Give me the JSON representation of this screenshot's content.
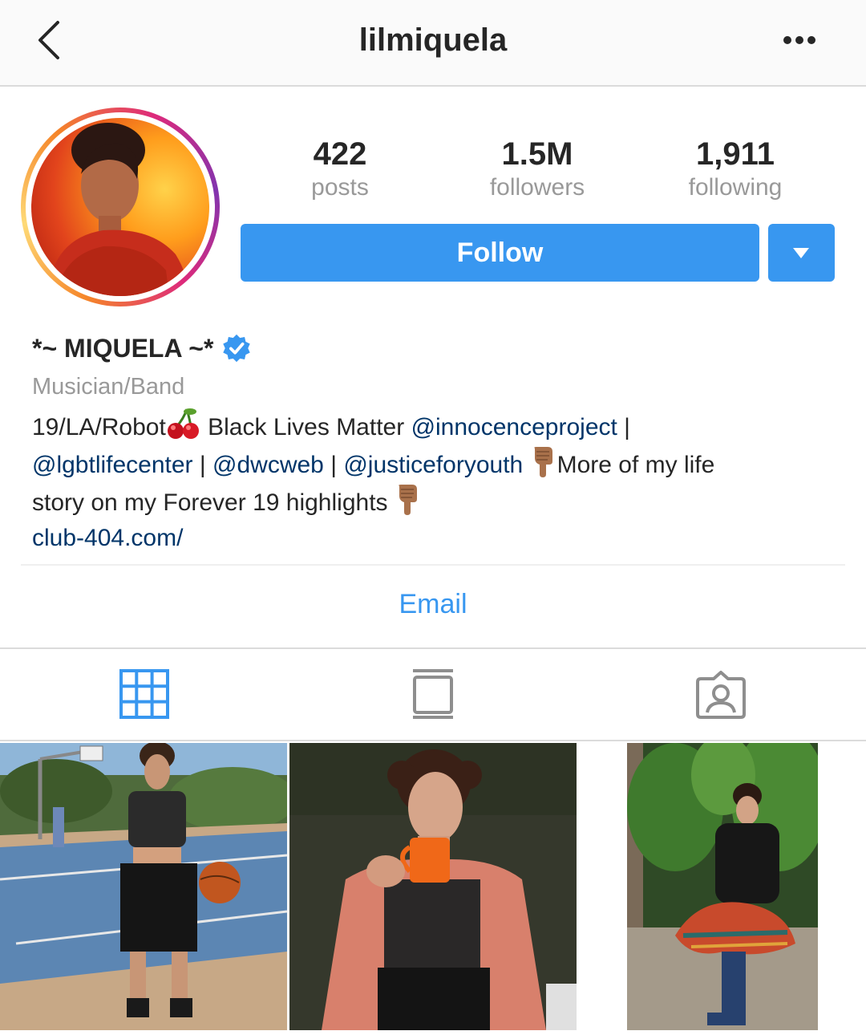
{
  "header": {
    "username": "lilmiquela",
    "back_icon": "chevron-left-icon",
    "more_icon": "more-horizontal-icon"
  },
  "stats": {
    "posts": {
      "value": "422",
      "label": "posts"
    },
    "followers": {
      "value": "1.5M",
      "label": "followers"
    },
    "following": {
      "value": "1,911",
      "label": "following"
    }
  },
  "actions": {
    "follow_label": "Follow",
    "dropdown_icon": "caret-down-icon"
  },
  "profile": {
    "display_name": "*~ MIQUELA ~*",
    "verified": true,
    "category": "Musician/Band",
    "bio": {
      "l1_text": "19/LA/Robot",
      "l1_text2": " Black Lives Matter ",
      "l1_mention": "@innocenceproject",
      "l1_sep": " |",
      "l2_mention1": "@lgbtlifecenter",
      "l2_sep1": " | ",
      "l2_mention2": "@dwcweb",
      "l2_sep2": " | ",
      "l2_mention3": "@justiceforyouth",
      "l2_text": "More of my life",
      "l3_text": "story on my Forever 19 highlights "
    },
    "website": "club-404.com/",
    "email_label": "Email"
  },
  "tabs": [
    {
      "name": "grid",
      "icon": "grid-icon",
      "active": true
    },
    {
      "name": "guides",
      "icon": "book-icon",
      "active": false
    },
    {
      "name": "tagged",
      "icon": "tagged-person-icon",
      "active": false
    }
  ],
  "colors": {
    "accent": "#3897f0",
    "mention": "#003569",
    "muted": "#999999",
    "text": "#262626"
  },
  "posts": [
    {
      "description": "basketball court photo"
    },
    {
      "description": "mug photo"
    },
    {
      "description": "plants photo"
    }
  ]
}
